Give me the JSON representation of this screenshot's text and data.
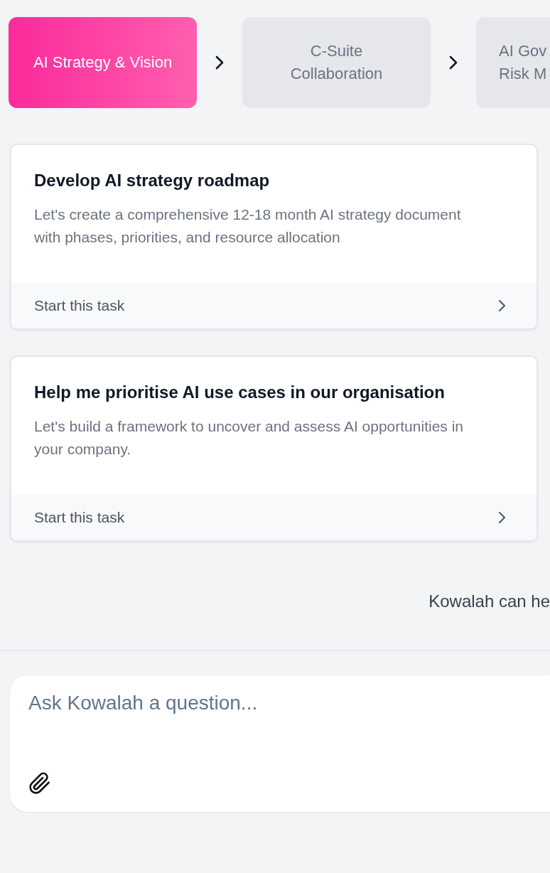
{
  "steps": [
    {
      "lines": [
        "AI Strategy & Vision"
      ],
      "selected": true
    },
    {
      "lines": [
        "C-Suite",
        "Collaboration"
      ],
      "selected": false
    },
    {
      "lines": [
        "AI Gov",
        "Risk M"
      ],
      "selected": false
    }
  ],
  "tasks": [
    {
      "title": "Develop AI strategy roadmap",
      "description": "Let's create a comprehensive 12-18 month AI strategy document with phases, priorities, and resource allocation",
      "action": "Start this task"
    },
    {
      "title": "Help me prioritise AI use cases in our organisation",
      "description": "Let's build a framework to uncover and assess AI opportunities in your company.",
      "action": "Start this task"
    }
  ],
  "footer_note": "Kowalah can he",
  "composer": {
    "placeholder": "Ask Kowalah a question..."
  }
}
